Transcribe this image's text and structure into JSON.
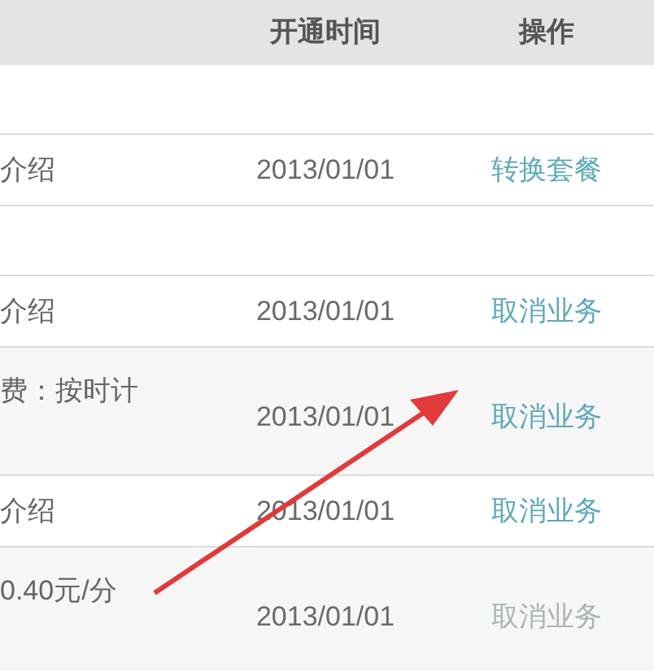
{
  "table": {
    "columns": [
      "开通时间",
      "操作"
    ],
    "rows": [
      {
        "kind": "blank"
      },
      {
        "kind": "single",
        "description": "介绍",
        "date": "2013/01/01",
        "action": "转换套餐",
        "disabled": false
      },
      {
        "kind": "blank"
      },
      {
        "kind": "single",
        "description": "介绍",
        "date": "2013/01/01",
        "action": "取消业务",
        "disabled": false
      },
      {
        "kind": "tall",
        "description": "费：按时计",
        "date": "2013/01/01",
        "action": "取消业务",
        "disabled": false
      },
      {
        "kind": "single",
        "description": "介绍",
        "date": "2013/01/01",
        "action": "取消业务",
        "disabled": false
      },
      {
        "kind": "tall",
        "description": "0.40元/分",
        "date": "2013/01/01",
        "action": "取消业务",
        "disabled": true
      }
    ]
  }
}
